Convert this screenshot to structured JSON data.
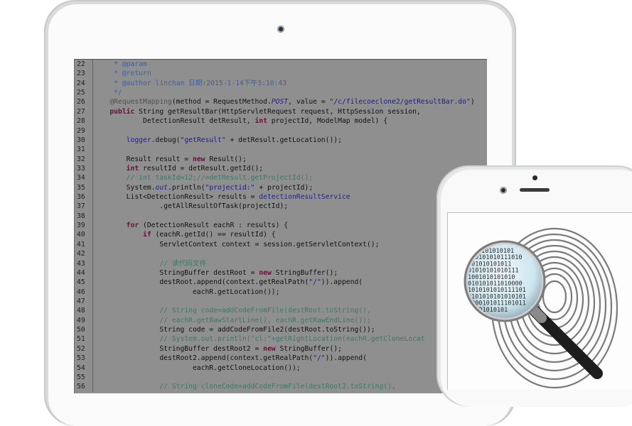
{
  "editor": {
    "lines": [
      {
        "n": "22",
        "html": "     <span class=\"doc\">* @param</span>"
      },
      {
        "n": "23",
        "html": "     <span class=\"doc\">* @return</span>"
      },
      {
        "n": "24",
        "html": "     <span class=\"doc\">* @author linchan 日期:2015-1-14下午3:10:43</span>"
      },
      {
        "n": "25",
        "html": "     <span class=\"doc\">*/</span>"
      },
      {
        "n": "26",
        "html": "    <span class=\"ann\">@RequestMapping</span>(method = RequestMethod.<span class=\"it\">POST</span>, value = <span class=\"str\">\"/c/filecoeclone2/getResultBar.do\"</span>)"
      },
      {
        "n": "27",
        "html": "    <span class=\"kw\">public</span> String getResultBar(HttpServletRequest request, HttpSession session,"
      },
      {
        "n": "28",
        "html": "            DetectionResult detResult, <span class=\"kw\">int</span> projectId, ModelMap model) {"
      },
      {
        "n": "29",
        "html": ""
      },
      {
        "n": "30",
        "html": "        <span class=\"fld\">logger</span>.debug(<span class=\"str\">\"getResult\"</span> + detResult.getLocation());"
      },
      {
        "n": "31",
        "html": ""
      },
      {
        "n": "32",
        "html": "        Result result = <span class=\"kw\">new</span> Result();"
      },
      {
        "n": "33",
        "html": "        <span class=\"kw\">int</span> resultId = detResult.getId();"
      },
      {
        "n": "34",
        "html": "        <span class=\"cm\">// int taskId=12;//=detResult.getProjectId();</span>"
      },
      {
        "n": "35",
        "html": "        System.<span class=\"it\">out</span>.println(<span class=\"str\">\"projectid:\"</span> + projectId);"
      },
      {
        "n": "36",
        "html": "        List&lt;DetectionResult&gt; results = <span class=\"fld\">detectionResultService</span>"
      },
      {
        "n": "37",
        "html": "                .getAllResultOfTask(projectId);"
      },
      {
        "n": "38",
        "html": ""
      },
      {
        "n": "39",
        "html": "        <span class=\"kw\">for</span> (DetectionResult eachR : results) {"
      },
      {
        "n": "40",
        "html": "            <span class=\"kw\">if</span> (eachR.getId() == resultId) {"
      },
      {
        "n": "41",
        "html": "                ServletContext context = session.getServletContext();"
      },
      {
        "n": "42",
        "html": ""
      },
      {
        "n": "43",
        "html": "                <span class=\"cm\">// 读代码文件</span>"
      },
      {
        "n": "44",
        "html": "                StringBuffer destRoot = <span class=\"kw\">new</span> StringBuffer();"
      },
      {
        "n": "45",
        "html": "                destRoot.append(context.getRealPath(<span class=\"str\">\"/\"</span>)).append("
      },
      {
        "n": "46",
        "html": "                        eachR.getLocation());"
      },
      {
        "n": "47",
        "html": ""
      },
      {
        "n": "48",
        "html": "                <span class=\"cm\">// String code=addCodeFromFile(destRoot.toString(),</span>"
      },
      {
        "n": "49",
        "html": "                <span class=\"cm\">// eachR.getRawStartLine(), eachR.getRawEndLine());</span>"
      },
      {
        "n": "50",
        "html": "                String code = addCodeFromFile2(destRoot.toString());"
      },
      {
        "n": "51",
        "html": "                <span class=\"cm\">// System.out.println(\"cl:\"+getRightLocation(eachR.getCloneLocat</span>"
      },
      {
        "n": "52",
        "html": "                StringBuffer destRoot2 = <span class=\"kw\">new</span> StringBuffer();"
      },
      {
        "n": "53",
        "html": "                destRoot2.append(context.getRealPath(<span class=\"str\">\"/\"</span>)).append("
      },
      {
        "n": "54",
        "html": "                        eachR.getCloneLocation());"
      },
      {
        "n": "55",
        "html": ""
      },
      {
        "n": "56",
        "html": "                <span class=\"cm\">// String cloneCode=addCodeFromFile(destRoot2.toString(),</span>"
      }
    ]
  },
  "lens": {
    "binary": [
      "0101010101",
      "0101010111010",
      "101010101011",
      "01010101010111",
      "1001010101010",
      "010101011010000",
      "1010101010111101",
      "0101010101010101",
      "1000101011101011",
      "10101010101"
    ]
  },
  "colors": {
    "screen_bg": "#8f8f8f",
    "lens_tint": "#d7ecf4",
    "handle": "#222222"
  }
}
